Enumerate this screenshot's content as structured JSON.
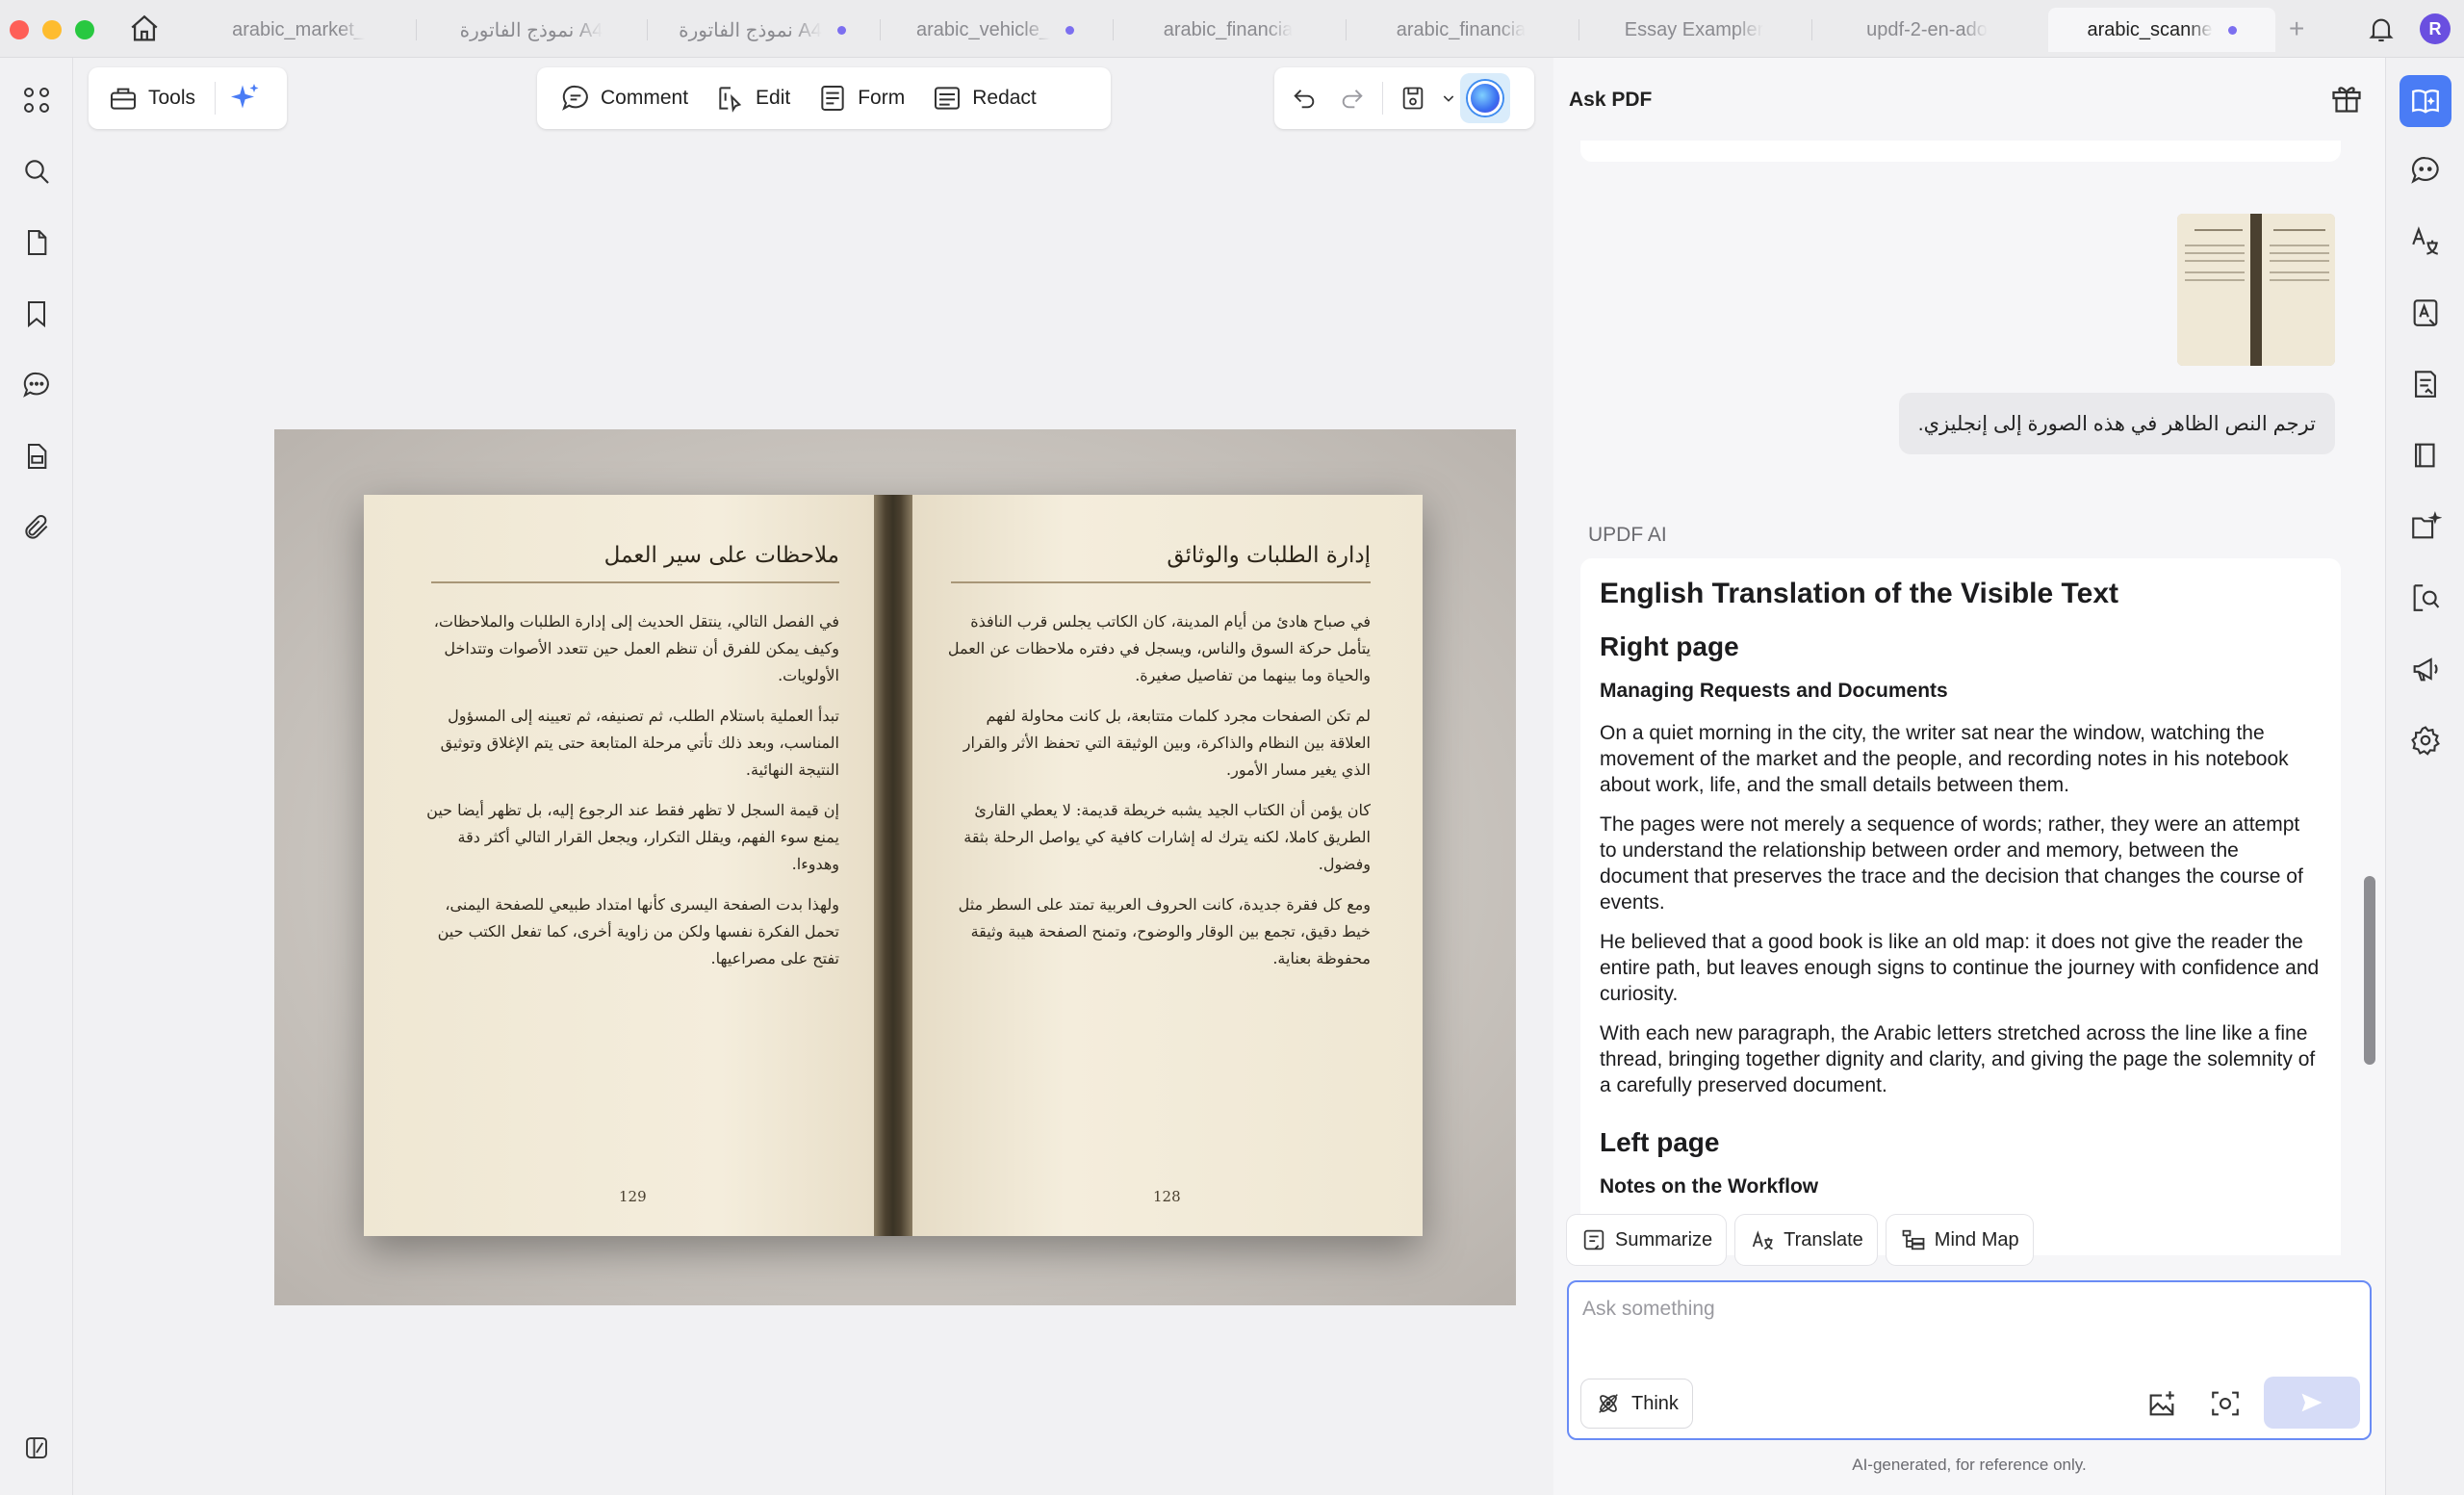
{
  "tabs": [
    {
      "label": "arabic_market_",
      "dot": false
    },
    {
      "label": "نموذج الفاتورة A4",
      "dot": false
    },
    {
      "label": "نموذج الفاتورة A4",
      "dot": true
    },
    {
      "label": "arabic_vehicle_",
      "dot": true
    },
    {
      "label": "arabic_financia",
      "dot": false
    },
    {
      "label": "arabic_financia",
      "dot": false
    },
    {
      "label": "Essay Exampler",
      "dot": false
    },
    {
      "label": "updf-2-en-ado",
      "dot": false
    },
    {
      "label": "arabic_scanne",
      "dot": true,
      "active": true
    }
  ],
  "user": {
    "initial": "R"
  },
  "toolbar": {
    "tools_label": "Tools",
    "comment_label": "Comment",
    "edit_label": "Edit",
    "form_label": "Form",
    "redact_label": "Redact"
  },
  "book": {
    "left_page": {
      "title": "ملاحظات على سير العمل",
      "paragraphs": [
        "في الفصل التالي، ينتقل الحديث إلى إدارة الطلبات والملاحظات، وكيف يمكن للفرق أن تنظم العمل حين تتعدد الأصوات وتتداخل الأولويات.",
        "تبدأ العملية باستلام الطلب، ثم تصنيفه، ثم تعيينه إلى المسؤول المناسب، وبعد ذلك تأتي مرحلة المتابعة حتى يتم الإغلاق وتوثيق النتيجة النهائية.",
        "إن قيمة السجل لا تظهر فقط عند الرجوع إليه، بل تظهر أيضا حين يمنع سوء الفهم، ويقلل التكرار، ويجعل القرار التالي أكثر دقة وهدوءا.",
        "ولهذا بدت الصفحة اليسرى كأنها امتداد طبيعي للصفحة اليمنى، تحمل الفكرة نفسها ولكن من زاوية أخرى، كما تفعل الكتب حين تفتح على مصراعيها."
      ],
      "page_number": "129"
    },
    "right_page": {
      "title": "إدارة الطلبات والوثائق",
      "paragraphs": [
        "في صباح هادئ من أيام المدينة، كان الكاتب يجلس قرب النافذة يتأمل حركة السوق والناس، ويسجل في دفتره ملاحظات عن العمل والحياة وما بينهما من تفاصيل صغيرة.",
        "لم تكن الصفحات مجرد كلمات متتابعة، بل كانت محاولة لفهم العلاقة بين النظام والذاكرة، وبين الوثيقة التي تحفظ الأثر والقرار الذي يغير مسار الأمور.",
        "كان يؤمن أن الكتاب الجيد يشبه خريطة قديمة: لا يعطي القارئ الطريق كاملا، لكنه يترك له إشارات كافية كي يواصل الرحلة بثقة وفضول.",
        "ومع كل فقرة جديدة، كانت الحروف العربية تمتد على السطر مثل خيط دقيق، تجمع بين الوقار والوضوح، وتمنح الصفحة هيبة وثيقة محفوظة بعناية."
      ],
      "page_number": "128"
    }
  },
  "ai_panel": {
    "title": "Ask PDF",
    "user_message": "ترجم النص الظاهر في هذه الصورة إلى إنجليزي.",
    "ai_label": "UPDF AI",
    "response": {
      "heading": "English Translation of the Visible Text",
      "right_heading": "Right page",
      "right_subheading": "Managing Requests and Documents",
      "right_paragraphs": [
        "On a quiet morning in the city, the writer sat near the window, watching the movement of the market and the people, and recording notes in his notebook about work, life, and the small details between them.",
        "The pages were not merely a sequence of words; rather, they were an attempt to understand the relationship between order and memory, between the document that preserves the trace and the decision that changes the course of events.",
        "He believed that a good book is like an old map: it does not give the reader the entire path, but leaves enough signs to continue the journey with confidence and curiosity.",
        "With each new paragraph, the Arabic letters stretched across the line like a fine thread, bringing together dignity and clarity, and giving the page the solemnity of a carefully preserved document."
      ],
      "left_heading": "Left page",
      "left_subheading": "Notes on the Workflow"
    },
    "actions": {
      "summarize": "Summarize",
      "translate": "Translate",
      "mind_map": "Mind Map"
    },
    "input": {
      "placeholder": "Ask something",
      "value": ""
    },
    "think_label": "Think",
    "disclaimer": "AI-generated, for reference only."
  },
  "colors": {
    "accent": "#4a7cf5",
    "tab_dot": "#7c6ff0",
    "input_border": "#6a8cf5"
  }
}
